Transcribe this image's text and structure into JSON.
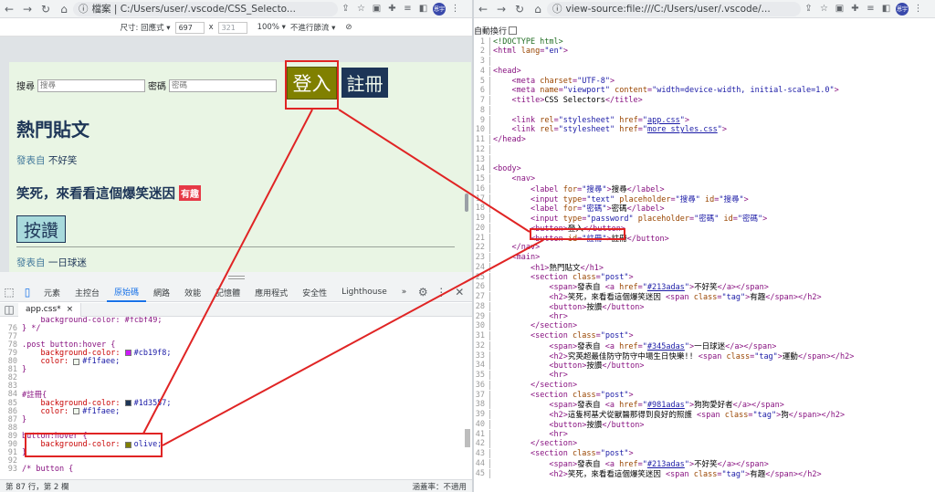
{
  "left_browser": {
    "address": "檔案 | C:/Users/user/.vscode/CSS_Selecto...",
    "avatar_label": "恩宇"
  },
  "device_toolbar": {
    "size_label": "尺寸: 回應式 ▾",
    "width": "697",
    "times": "x",
    "height": "321",
    "zoom": "100% ▾",
    "throttle": "不進行節流 ▾"
  },
  "page": {
    "search_label": "搜尋",
    "search_placeholder": "搜尋",
    "password_label": "密碼",
    "password_placeholder": "密碼",
    "login_button": "登入",
    "register_button": "註冊",
    "heading": "熱門貼文",
    "post1_prefix": "發表自 ",
    "post1_author": "不好笑",
    "post1_title": "笑死，來看看這個爆笑迷因",
    "post1_tag": "有趣",
    "like_button": "按讚",
    "post2_prefix": "發表自 ",
    "post2_author": "一日球迷"
  },
  "devtools": {
    "tabs": [
      "元素",
      "主控台",
      "原始碼",
      "網路",
      "效能",
      "記憶體",
      "應用程式",
      "安全性",
      "Lighthouse",
      "»"
    ],
    "active_tab": "原始碼",
    "file_tab": "app.css*",
    "file_close": "×",
    "status_left": "第 87 行，第 2 欄",
    "status_right": "涵蓋率：不適用",
    "lines": [
      {
        "n": "",
        "text": "    background-color: #fcbf49;"
      },
      {
        "n": "76",
        "text": "} */"
      },
      {
        "n": "77",
        "text": ""
      },
      {
        "n": "78",
        "text": ".post button:hover {"
      },
      {
        "n": "79",
        "prop": "    background-color: ",
        "swatch": "#cb19f8",
        "val": "#cb19f8;"
      },
      {
        "n": "80",
        "prop": "    color: ",
        "swatch": "#f1faee",
        "val": "#f1faee;"
      },
      {
        "n": "81",
        "text": "}"
      },
      {
        "n": "82",
        "text": ""
      },
      {
        "n": "83",
        "text": ""
      },
      {
        "n": "84",
        "text": "#註冊{"
      },
      {
        "n": "85",
        "prop": "    background-color: ",
        "swatch": "#1d3557",
        "val": "#1d3557;"
      },
      {
        "n": "86",
        "prop": "    color: ",
        "swatch": "#f1faee",
        "val": "#f1faee;"
      },
      {
        "n": "87",
        "text": "}"
      },
      {
        "n": "88",
        "text": ""
      },
      {
        "n": "89",
        "text": "button:hover {"
      },
      {
        "n": "90",
        "prop": "    background-color: ",
        "swatch": "#808000",
        "val": "olive;"
      },
      {
        "n": "91",
        "text": "}"
      },
      {
        "n": "92",
        "text": ""
      },
      {
        "n": "93",
        "text": "/* button {"
      }
    ]
  },
  "right_browser": {
    "address": "view-source:file:///C:/Users/user/.vscode/...",
    "avatar_label": "恩宇",
    "wrap_label": "自動換行",
    "lines": [
      {
        "n": "1",
        "html": "<span class='c'>&lt;!DOCTYPE html&gt;</span>"
      },
      {
        "n": "2",
        "html": "<span class='t'>&lt;html </span><span class='a'>lang</span><span class='t'>=</span><span class='v'>\"en\"</span><span class='t'>&gt;</span>"
      },
      {
        "n": "3",
        "html": ""
      },
      {
        "n": "4",
        "html": "<span class='t'>&lt;head&gt;</span>"
      },
      {
        "n": "5",
        "html": "    <span class='t'>&lt;meta </span><span class='a'>charset</span><span class='t'>=</span><span class='v'>\"UTF-8\"</span><span class='t'>&gt;</span>"
      },
      {
        "n": "6",
        "html": "    <span class='t'>&lt;meta </span><span class='a'>name</span><span class='t'>=</span><span class='v'>\"viewport\"</span> <span class='a'>content</span><span class='t'>=</span><span class='v'>\"width=device-width, initial-scale=1.0\"</span><span class='t'>&gt;</span>"
      },
      {
        "n": "7",
        "html": "    <span class='t'>&lt;title&gt;</span><span class='txt'>CSS Selectors</span><span class='t'>&lt;/title&gt;</span>"
      },
      {
        "n": "8",
        "html": ""
      },
      {
        "n": "9",
        "html": "    <span class='t'>&lt;link </span><span class='a'>rel</span><span class='t'>=</span><span class='v'>\"stylesheet\"</span> <span class='a'>href</span><span class='t'>=</span><span class='v'>\"</span><span class='u'>app.css</span><span class='v'>\"</span><span class='t'>&gt;</span>"
      },
      {
        "n": "10",
        "html": "    <span class='t'>&lt;link </span><span class='a'>rel</span><span class='t'>=</span><span class='v'>\"stylesheet\"</span> <span class='a'>href</span><span class='t'>=</span><span class='v'>\"</span><span class='u'>more_styles.css</span><span class='v'>\"</span><span class='t'>&gt;</span>"
      },
      {
        "n": "11",
        "html": "<span class='t'>&lt;/head&gt;</span>"
      },
      {
        "n": "12",
        "html": ""
      },
      {
        "n": "13",
        "html": ""
      },
      {
        "n": "14",
        "html": "<span class='t'>&lt;body&gt;</span>"
      },
      {
        "n": "15",
        "html": "    <span class='t'>&lt;nav&gt;</span>"
      },
      {
        "n": "16",
        "html": "        <span class='t'>&lt;label </span><span class='a'>for</span><span class='t'>=</span><span class='v'>\"搜尋\"</span><span class='t'>&gt;</span><span class='txt'>搜尋</span><span class='t'>&lt;/label&gt;</span>"
      },
      {
        "n": "17",
        "html": "        <span class='t'>&lt;input </span><span class='a'>type</span><span class='t'>=</span><span class='v'>\"text\"</span> <span class='a'>placeholder</span><span class='t'>=</span><span class='v'>\"搜尋\"</span> <span class='a'>id</span><span class='t'>=</span><span class='v'>\"搜尋\"</span><span class='t'>&gt;</span>"
      },
      {
        "n": "18",
        "html": "        <span class='t'>&lt;label </span><span class='a'>for</span><span class='t'>=</span><span class='v'>\"密碼\"</span><span class='t'>&gt;</span><span class='txt'>密碼</span><span class='t'>&lt;/label&gt;</span>"
      },
      {
        "n": "19",
        "html": "        <span class='t'>&lt;input </span><span class='a'>type</span><span class='t'>=</span><span class='v'>\"password\"</span> <span class='a'>placeholder</span><span class='t'>=</span><span class='v'>\"密碼\"</span> <span class='a'>id</span><span class='t'>=</span><span class='v'>\"密碼\"</span><span class='t'>&gt;</span>"
      },
      {
        "n": "20",
        "html": "        <span class='t'>&lt;button&gt;</span><span class='txt'>登入</span><span class='t'>&lt;/button&gt;</span>"
      },
      {
        "n": "21",
        "html": "        <span class='t'>&lt;button </span><span class='a'>id</span><span class='t'>=</span><span class='v'>\"註冊\"</span><span class='t'>&gt;</span><span class='txt'>註冊</span><span class='t'>&lt;/button&gt;</span>"
      },
      {
        "n": "22",
        "html": "    <span class='t'>&lt;/nav&gt;</span>"
      },
      {
        "n": "23",
        "html": "    <span class='t'>&lt;main&gt;</span>"
      },
      {
        "n": "24",
        "html": "        <span class='t'>&lt;h1&gt;</span><span class='txt'>熱門貼文</span><span class='t'>&lt;/h1&gt;</span>"
      },
      {
        "n": "25",
        "html": "        <span class='t'>&lt;section </span><span class='a'>class</span><span class='t'>=</span><span class='v'>\"post\"</span><span class='t'>&gt;</span>"
      },
      {
        "n": "26",
        "html": "            <span class='t'>&lt;span&gt;</span><span class='txt'>發表自 </span><span class='t'>&lt;a </span><span class='a'>href</span><span class='t'>=</span><span class='v'>\"</span><span class='u'>#213adas</span><span class='v'>\"</span><span class='t'>&gt;</span><span class='txt'>不好笑</span><span class='t'>&lt;/a&gt;&lt;/span&gt;</span>"
      },
      {
        "n": "27",
        "html": "            <span class='t'>&lt;h2&gt;</span><span class='txt'>笑死，來看看這個爆笑迷因 </span><span class='t'>&lt;span </span><span class='a'>class</span><span class='t'>=</span><span class='v'>\"tag\"</span><span class='t'>&gt;</span><span class='txt'>有趣</span><span class='t'>&lt;/span&gt;&lt;/h2&gt;</span>"
      },
      {
        "n": "28",
        "html": "            <span class='t'>&lt;button&gt;</span><span class='txt'>按讚</span><span class='t'>&lt;/button&gt;</span>"
      },
      {
        "n": "29",
        "html": "            <span class='t'>&lt;hr&gt;</span>"
      },
      {
        "n": "30",
        "html": "        <span class='t'>&lt;/section&gt;</span>"
      },
      {
        "n": "31",
        "html": "        <span class='t'>&lt;section </span><span class='a'>class</span><span class='t'>=</span><span class='v'>\"post\"</span><span class='t'>&gt;</span>"
      },
      {
        "n": "32",
        "html": "            <span class='t'>&lt;span&gt;</span><span class='txt'>發表自 </span><span class='t'>&lt;a </span><span class='a'>href</span><span class='t'>=</span><span class='v'>\"</span><span class='u'>#345adas</span><span class='v'>\"</span><span class='t'>&gt;</span><span class='txt'>一日球迷</span><span class='t'>&lt;/a&gt;&lt;/span&gt;</span>"
      },
      {
        "n": "33",
        "html": "            <span class='t'>&lt;h2&gt;</span><span class='txt'>究英超最佳防守防守中場生日快樂!! </span><span class='t'>&lt;span </span><span class='a'>class</span><span class='t'>=</span><span class='v'>\"tag\"</span><span class='t'>&gt;</span><span class='txt'>運動</span><span class='t'>&lt;/span&gt;&lt;/h2&gt;</span>"
      },
      {
        "n": "34",
        "html": "            <span class='t'>&lt;button&gt;</span><span class='txt'>按讚</span><span class='t'>&lt;/button&gt;</span>"
      },
      {
        "n": "35",
        "html": "            <span class='t'>&lt;hr&gt;</span>"
      },
      {
        "n": "36",
        "html": "        <span class='t'>&lt;/section&gt;</span>"
      },
      {
        "n": "37",
        "html": "        <span class='t'>&lt;section </span><span class='a'>class</span><span class='t'>=</span><span class='v'>\"post\"</span><span class='t'>&gt;</span>"
      },
      {
        "n": "38",
        "html": "            <span class='t'>&lt;span&gt;</span><span class='txt'>發表自 </span><span class='t'>&lt;a </span><span class='a'>href</span><span class='t'>=</span><span class='v'>\"</span><span class='u'>#981adas</span><span class='v'>\"</span><span class='t'>&gt;</span><span class='txt'>狗狗愛好者</span><span class='t'>&lt;/a&gt;&lt;/span&gt;</span>"
      },
      {
        "n": "39",
        "html": "            <span class='t'>&lt;h2&gt;</span><span class='txt'>這隻柯基犬從獸醫那得到良好的照護 </span><span class='t'>&lt;span </span><span class='a'>class</span><span class='t'>=</span><span class='v'>\"tag\"</span><span class='t'>&gt;</span><span class='txt'>狗</span><span class='t'>&lt;/span&gt;&lt;/h2&gt;</span>"
      },
      {
        "n": "40",
        "html": "            <span class='t'>&lt;button&gt;</span><span class='txt'>按讚</span><span class='t'>&lt;/button&gt;</span>"
      },
      {
        "n": "41",
        "html": "            <span class='t'>&lt;hr&gt;</span>"
      },
      {
        "n": "42",
        "html": "        <span class='t'>&lt;/section&gt;</span>"
      },
      {
        "n": "43",
        "html": "        <span class='t'>&lt;section </span><span class='a'>class</span><span class='t'>=</span><span class='v'>\"post\"</span><span class='t'>&gt;</span>"
      },
      {
        "n": "44",
        "html": "            <span class='t'>&lt;span&gt;</span><span class='txt'>發表自 </span><span class='t'>&lt;a </span><span class='a'>href</span><span class='t'>=</span><span class='v'>\"</span><span class='u'>#213adas</span><span class='v'>\"</span><span class='t'>&gt;</span><span class='txt'>不好笑</span><span class='t'>&lt;/a&gt;&lt;/span&gt;</span>"
      },
      {
        "n": "45",
        "html": "            <span class='t'>&lt;h2&gt;</span><span class='txt'>笑死，來看看這個爆笑迷因 </span><span class='t'>&lt;span </span><span class='a'>class</span><span class='t'>=</span><span class='v'>\"tag\"</span><span class='t'>&gt;</span><span class='txt'>有趣</span><span class='t'>&lt;/span&gt;&lt;/h2&gt;</span>"
      }
    ]
  }
}
